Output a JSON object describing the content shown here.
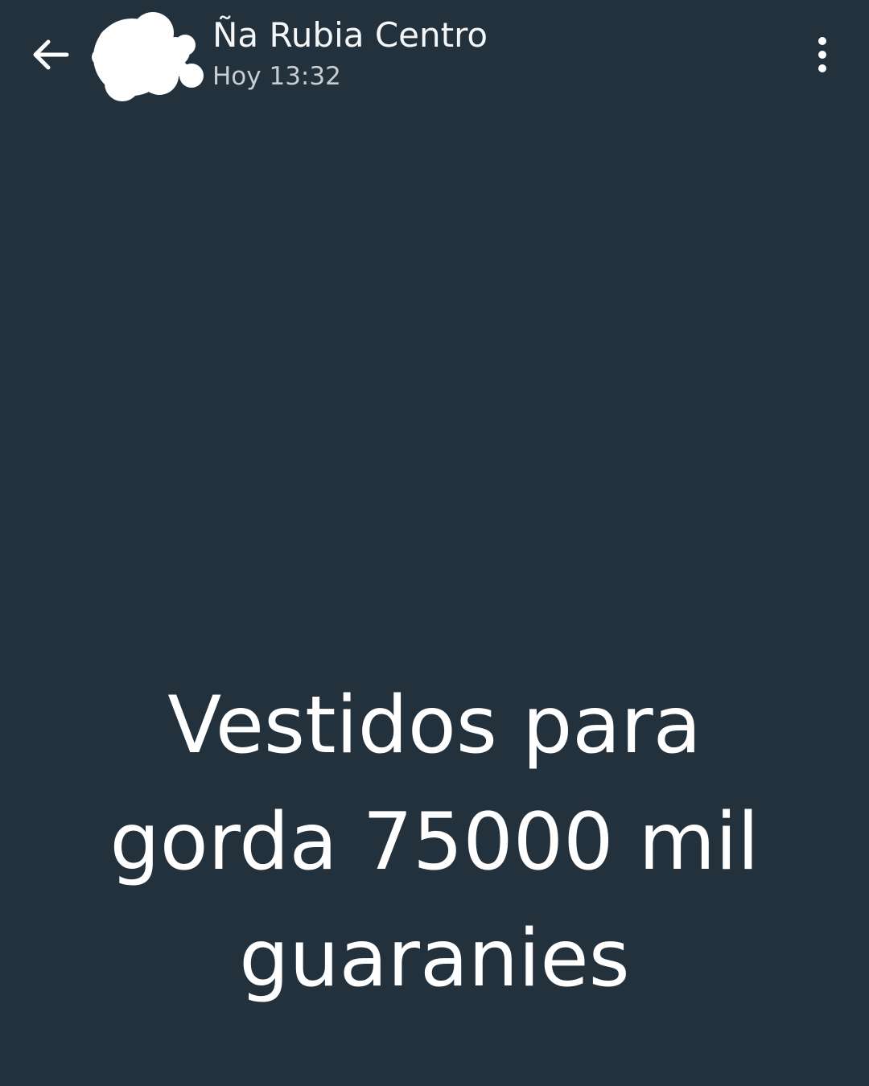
{
  "header": {
    "back_icon": "arrow-left-icon",
    "avatar_icon": "blurred-avatar",
    "contact_name": "Ña Rubia Centro",
    "timestamp": "Hoy 13:32",
    "menu_icon": "more-vertical-icon"
  },
  "status": {
    "lines": [
      "Vestidos para",
      "gorda 75000 mil",
      "guaranies"
    ],
    "background_color": "#23313d",
    "text_color": "#ffffff"
  }
}
